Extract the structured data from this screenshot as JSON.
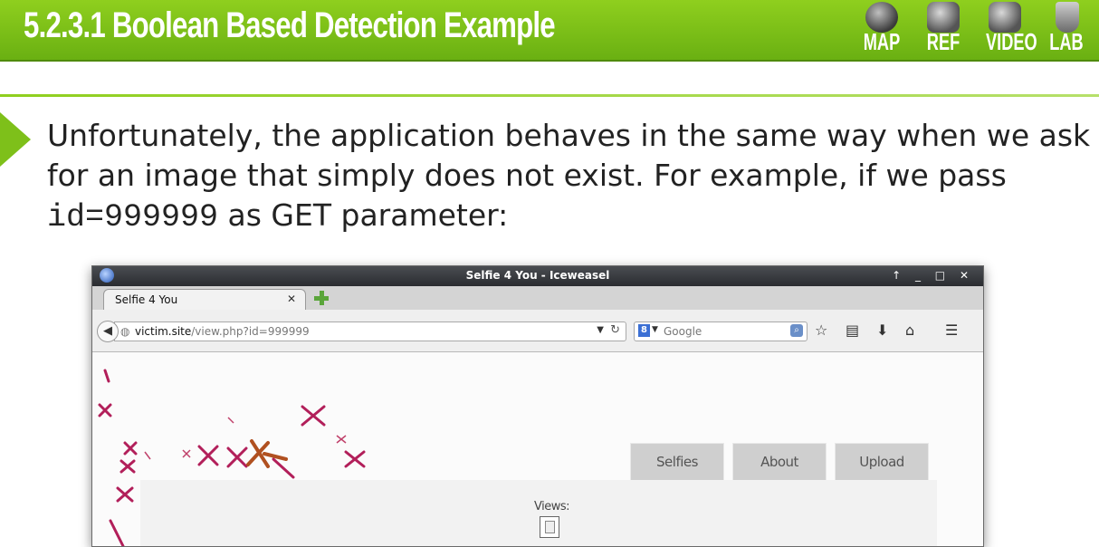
{
  "slide": {
    "title": "5.2.3.1 Boolean Based Detection Example",
    "nav": {
      "map": "MAP",
      "ref": "REF",
      "video": "VIDEO",
      "lab": "LAB"
    },
    "paragraph": {
      "part1": "Unfortunately, the application behaves in the same way when we ask for an image that simply does not exist. For example, if we pass ",
      "code": "id=999999",
      "part2": " as GET parameter:"
    },
    "accent_color": "#7ec01a"
  },
  "browser": {
    "window_title": "Selfie 4 You - Iceweasel",
    "window_controls": "↑ _ □ ✕",
    "tab_title": "Selfie 4 You",
    "tab_close": "✕",
    "url_host": "victim.site",
    "url_path": "/view.php?id=999999",
    "search_engine_icon": "8",
    "search_placeholder": "Google",
    "toolbar_icons": [
      "star-icon",
      "clipboard-icon",
      "download-icon",
      "home-icon",
      "menu-icon"
    ]
  },
  "page": {
    "menu": [
      "Selfies",
      "About",
      "Upload"
    ],
    "views_label": "Views:"
  }
}
